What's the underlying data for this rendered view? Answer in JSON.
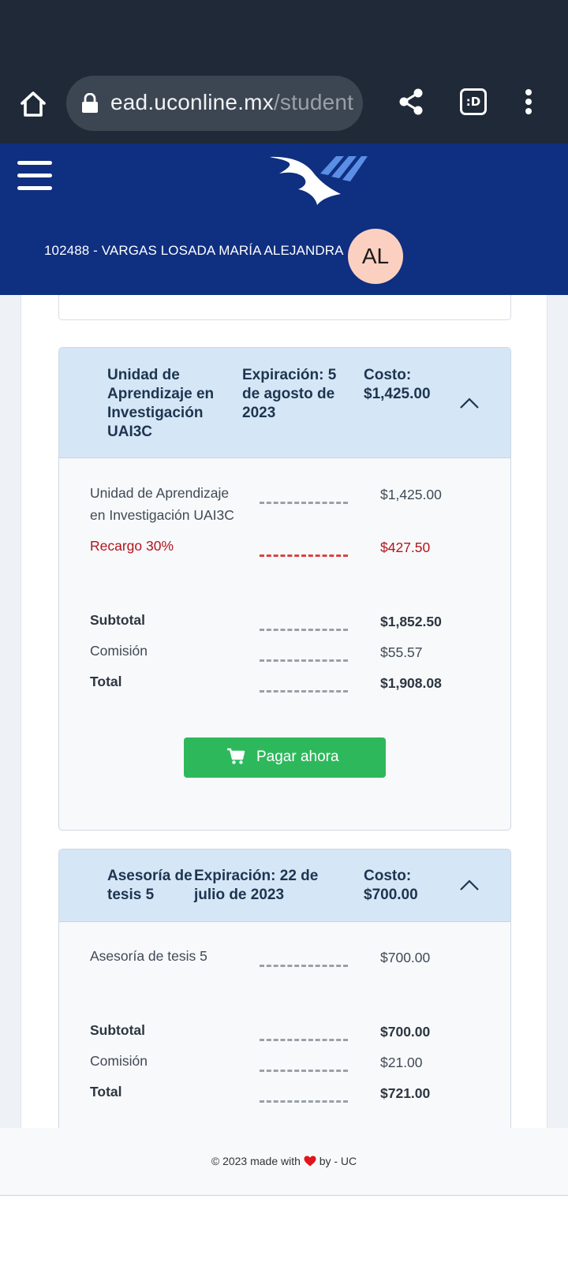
{
  "browser": {
    "url_host": "ead.uconline.mx",
    "url_path": "/student",
    "tab_button_label": ":D",
    "icons": [
      "home-icon",
      "lock-icon",
      "share-icon",
      "more-vert-icon"
    ]
  },
  "header": {
    "user_label": "102488 - VARGAS LOSADA MARÍA ALEJANDRA",
    "avatar_initials": "AL",
    "colors": {
      "header_bg": "#0f2f80",
      "avatar_bg": "#fcd0c0"
    }
  },
  "cards": [
    {
      "title": "Unidad de Aprendizaje en Investigación UAI3C",
      "title_lines": [
        "Unidad de",
        "Aprendizaje en",
        "Investigación",
        "UAI3C"
      ],
      "expiration_lines": [
        "Expiración: 5",
        "de agosto de",
        "2023"
      ],
      "cost_lines": [
        "Costo:",
        "$1,425.00"
      ],
      "items": [
        {
          "label_lines": [
            "Unidad de Aprendizaje",
            "en Investigación UAI3C"
          ],
          "value": "$1,425.00"
        },
        {
          "label_lines": [
            "Recargo 30%"
          ],
          "value": "$427.50"
        }
      ],
      "subtotal": {
        "label": "Subtotal",
        "value": "$1,852.50"
      },
      "commission": {
        "label": "Comisión",
        "value": "$55.57"
      },
      "total": {
        "label": "Total",
        "value": "$1,908.08"
      },
      "pay_button": "Pagar ahora"
    },
    {
      "title_lines": [
        "Asesoría de",
        "tesis 5"
      ],
      "expiration_lines": [
        "Expiración: 22 de",
        "julio de 2023"
      ],
      "cost_lines": [
        "Costo:",
        "$700.00"
      ],
      "items": [
        {
          "label_lines": [
            "Asesoría de tesis 5"
          ],
          "value": "$700.00"
        }
      ],
      "subtotal": {
        "label": "Subtotal",
        "value": "$700.00"
      },
      "commission": {
        "label": "Comisión",
        "value": "$21.00"
      },
      "total": {
        "label": "Total",
        "value": "$721.00"
      }
    }
  ],
  "footer": {
    "prefix": "© 2023 made with",
    "suffix": "by - UC"
  },
  "colors": {
    "pay_button": "#2eb85c",
    "surcharge_red": "#b3151b",
    "card_header_bg": "#d5e6f6"
  }
}
